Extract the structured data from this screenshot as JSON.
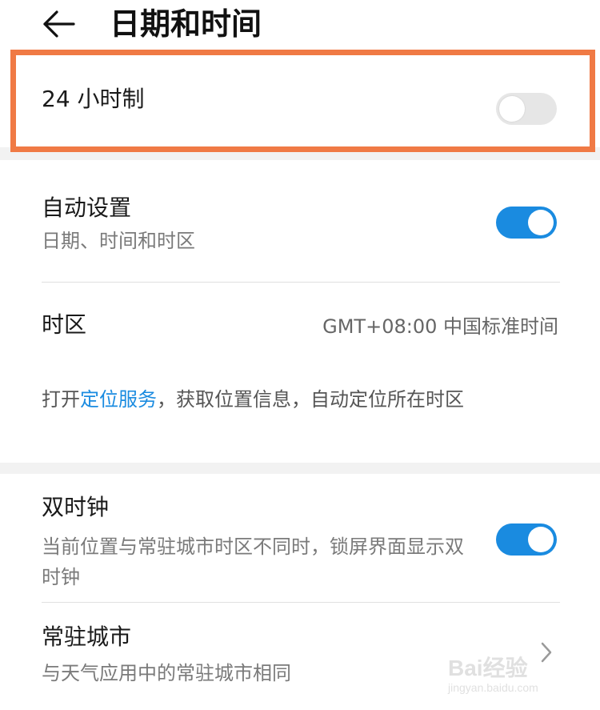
{
  "header": {
    "title": "日期和时间",
    "back_icon": "arrow-left-icon"
  },
  "hour24": {
    "label": "24 小时制",
    "enabled": false
  },
  "auto_setting": {
    "title": "自动设置",
    "subtitle": "日期、时间和时区",
    "enabled": true
  },
  "timezone": {
    "title": "时区",
    "value": "GMT+08:00 中国标准时间"
  },
  "location_info": {
    "prefix": "打开",
    "link": "定位服务",
    "suffix": "，获取位置信息，自动定位所在时区"
  },
  "dual_clock": {
    "title": "双时钟",
    "subtitle": "当前位置与常驻城市时区不同时，锁屏界面显示双时钟",
    "enabled": true
  },
  "home_city": {
    "title": "常驻城市",
    "subtitle": "与天气应用中的常驻城市相同",
    "chevron_icon": "chevron-right-icon"
  },
  "watermark": {
    "logo": "Bai经验",
    "url": "jingyan.baidu.com"
  },
  "colors": {
    "accent": "#1a8be0",
    "highlight": "#f07a45",
    "toggle_off": "#e6e6e6"
  }
}
